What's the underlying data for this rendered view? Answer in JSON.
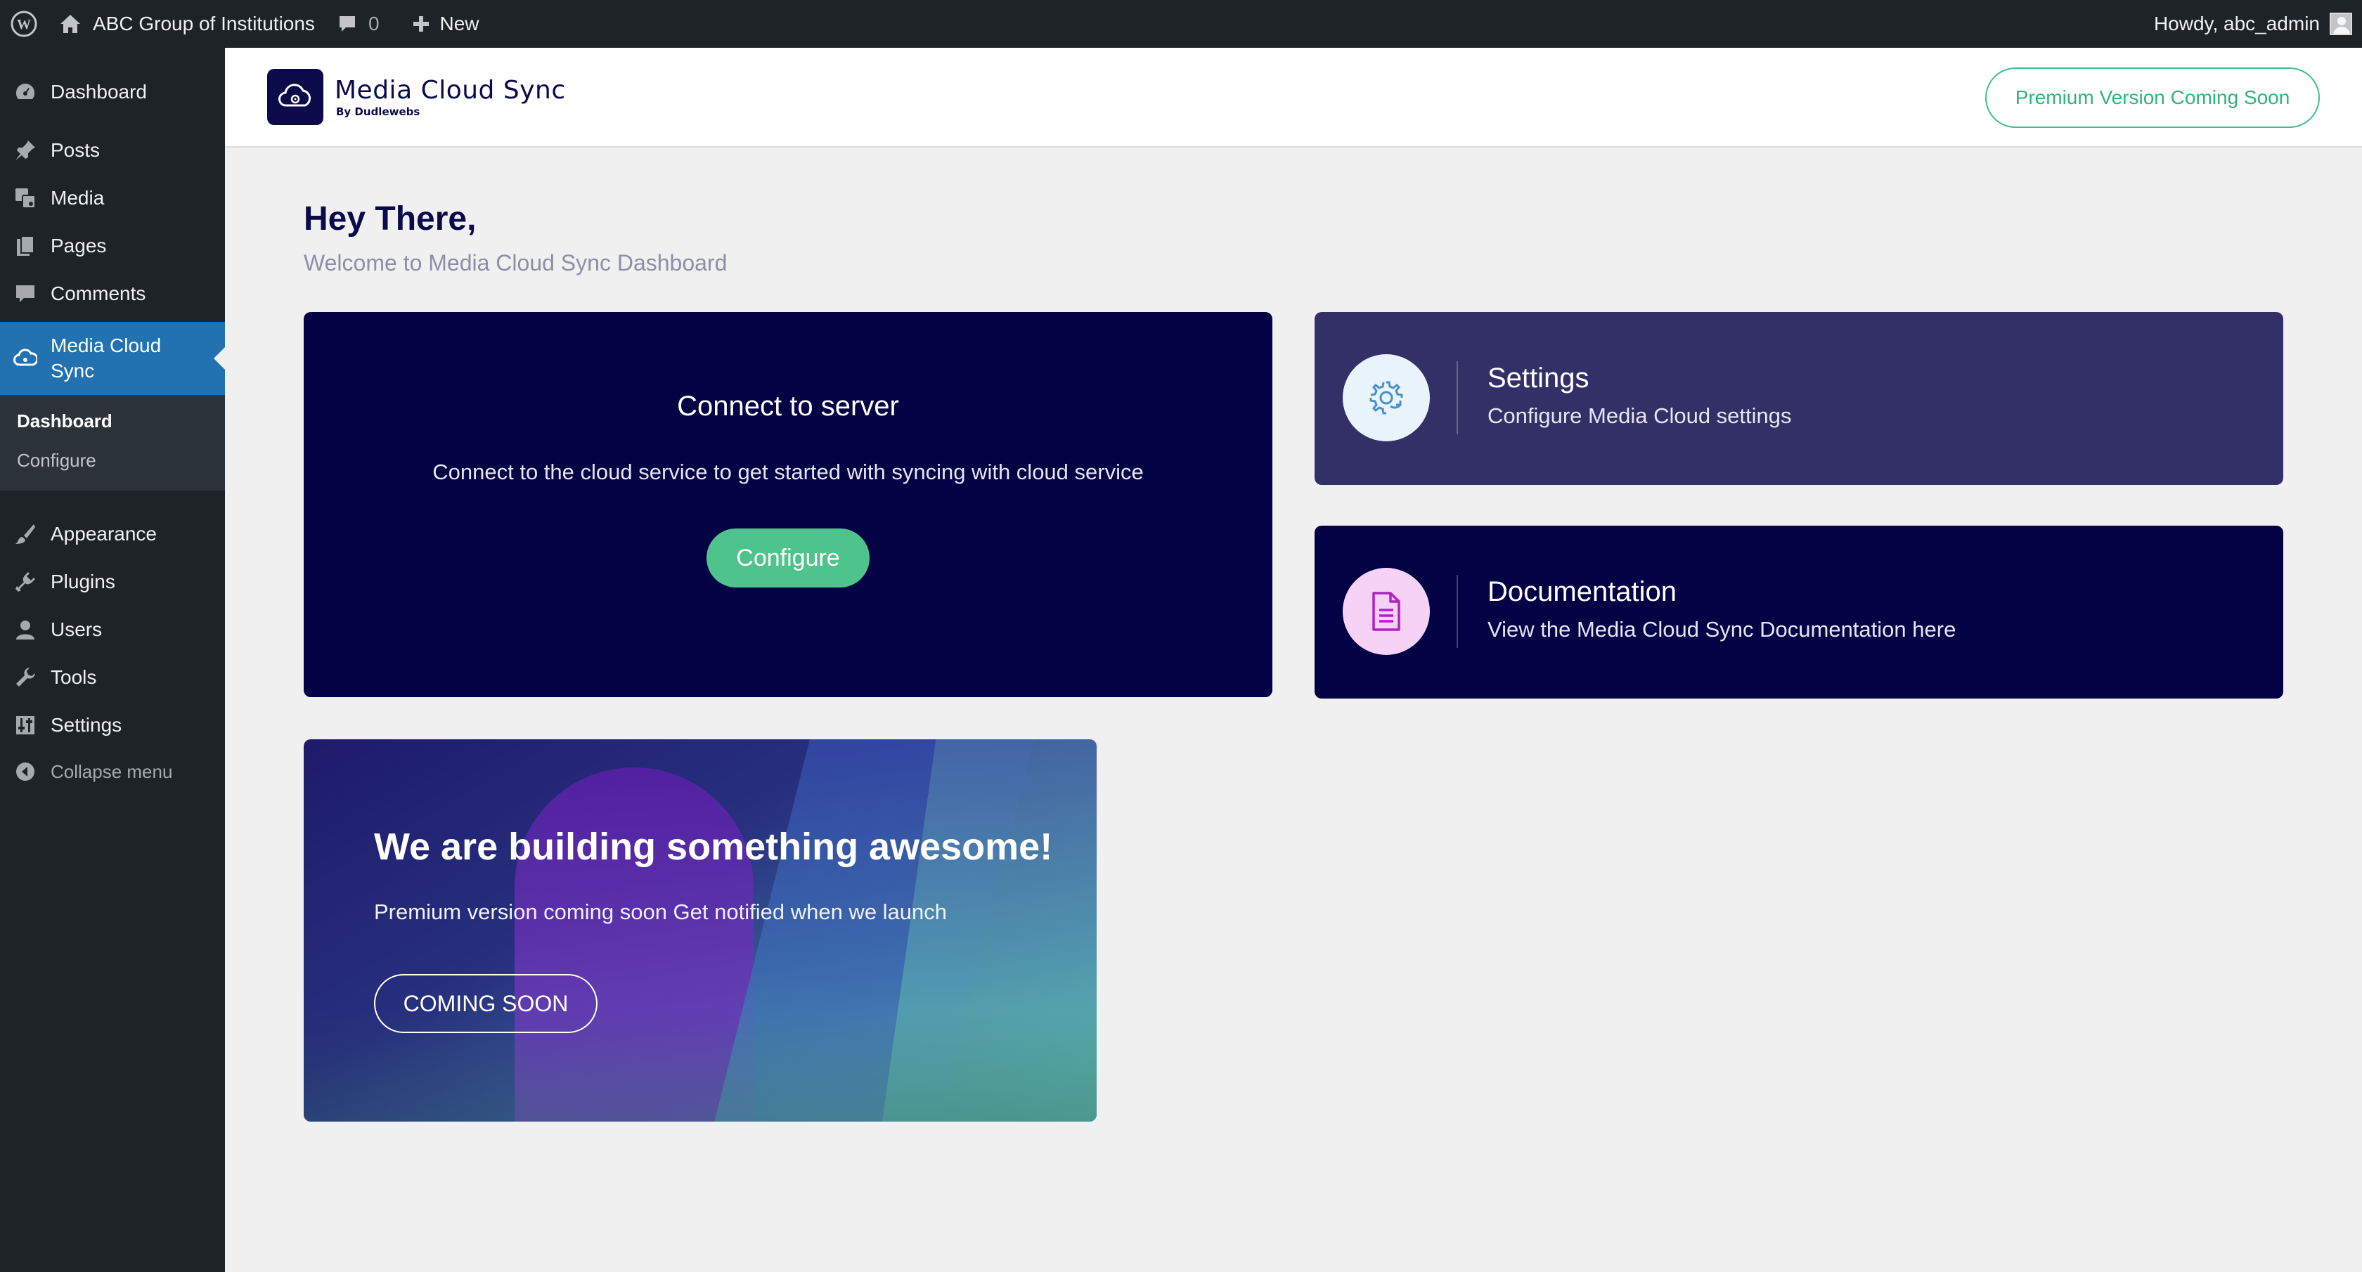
{
  "admin_bar": {
    "site_name": "ABC Group of Institutions",
    "comments_count": "0",
    "new_label": "New",
    "howdy": "Howdy, abc_admin"
  },
  "sidebar": {
    "items": [
      {
        "label": "Dashboard",
        "icon": "dashboard-icon"
      },
      {
        "label": "Posts",
        "icon": "pin-icon"
      },
      {
        "label": "Media",
        "icon": "media-icon"
      },
      {
        "label": "Pages",
        "icon": "pages-icon"
      },
      {
        "label": "Comments",
        "icon": "comment-icon"
      },
      {
        "label": "Media Cloud Sync",
        "label_line1": "Media Cloud",
        "label_line2": "Sync",
        "icon": "cloud-icon",
        "active": true
      },
      {
        "label": "Appearance",
        "icon": "brush-icon"
      },
      {
        "label": "Plugins",
        "icon": "plug-icon"
      },
      {
        "label": "Users",
        "icon": "user-icon"
      },
      {
        "label": "Tools",
        "icon": "wrench-icon"
      },
      {
        "label": "Settings",
        "icon": "sliders-icon"
      }
    ],
    "submenu": [
      {
        "label": "Dashboard",
        "current": true
      },
      {
        "label": "Configure"
      }
    ],
    "collapse_label": "Collapse menu"
  },
  "header": {
    "logo_title": "Media Cloud Sync",
    "logo_subtitle": "By Dudlewebs",
    "premium_label": "Premium Version Coming Soon"
  },
  "main": {
    "greeting": "Hey There,",
    "welcome": "Welcome to Media Cloud Sync Dashboard",
    "connect_card": {
      "title": "Connect to server",
      "description": "Connect to the cloud service to get started with syncing with cloud service",
      "button": "Configure"
    },
    "settings_card": {
      "title": "Settings",
      "description": "Configure Media Cloud settings",
      "icon": "gear-sync-icon"
    },
    "docs_card": {
      "title": "Documentation",
      "description": "View the Media Cloud Sync Documentation here",
      "icon": "document-icon"
    },
    "promo": {
      "title": "We are building something awesome!",
      "description": "Premium version coming soon Get notified when we launch",
      "button": "COMING SOON"
    }
  },
  "colors": {
    "navy": "#020245",
    "settings_card": "#333068",
    "accent_green": "#4fc38c",
    "wp_admin_bg": "#1d2327",
    "wp_active": "#2271b1"
  }
}
